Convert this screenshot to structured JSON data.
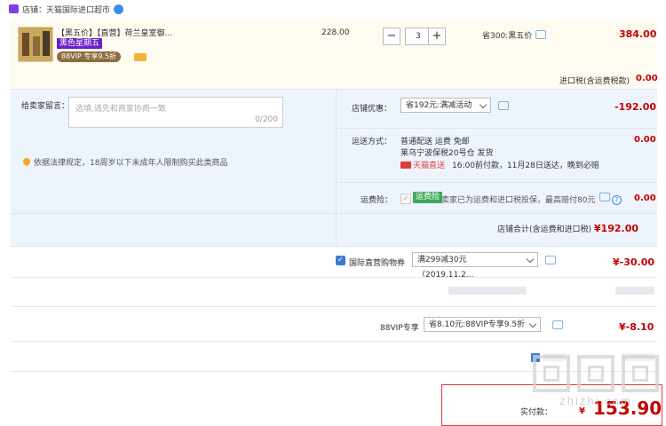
{
  "store": {
    "label": "店铺：天猫国际进口超市"
  },
  "product": {
    "title": "【黑五价】【直营】荷兰皇室御...",
    "promo_badge": "黑色星期五",
    "vip_tag": "88VIP 专享9.5折",
    "unit_price": "228.00",
    "quantity": "3",
    "qty_minus": "−",
    "qty_plus": "+",
    "saving": "省300:黑五价",
    "subtotal": "384.00"
  },
  "tax": {
    "label": "进口税(含运费税款)",
    "value": "0.00"
  },
  "message": {
    "label": "给卖家留言：",
    "placeholder": "选填,请先和商家协商一致",
    "count": "0/200"
  },
  "law_notice": "依据法律规定，18周岁以下未成年人限制购买此类商品",
  "store_discount": {
    "label": "店铺优惠：",
    "selected": "省192元:满减活动",
    "value": "-192.00"
  },
  "shipping": {
    "label": "运送方式：",
    "line1": "普通配送 运费 免邮",
    "line2": "莱乌宁波保税20号仓  发货",
    "tmall_text": "天猫直送",
    "line3": "16:00前付款，11月28日送达，晚到必赔",
    "value": "0.00"
  },
  "insurance": {
    "label": "运费险：",
    "badge": "运费险",
    "text": "卖家已为运费和进口税投保，最高赔付80元",
    "help": "?",
    "value": "0.00"
  },
  "store_total": {
    "label": "店铺合计(含运费和进口税)",
    "value": "¥192.00"
  },
  "coupon": {
    "label": "国际直营购物券",
    "selected": "满299减30元（2019.11.2...",
    "value": "¥-30.00"
  },
  "vip": {
    "label": "88VIP专享",
    "selected": "省8.10元:88VIP专享9.5折",
    "value": "¥-8.10"
  },
  "payment": {
    "label": "实付款：",
    "currency": "¥",
    "value": "153.90"
  },
  "watermark": "zhizhi.com",
  "colors": {
    "price_red": "#c40000",
    "accent_blue": "#3a7bd5",
    "section_bg": "#eef4fb"
  }
}
